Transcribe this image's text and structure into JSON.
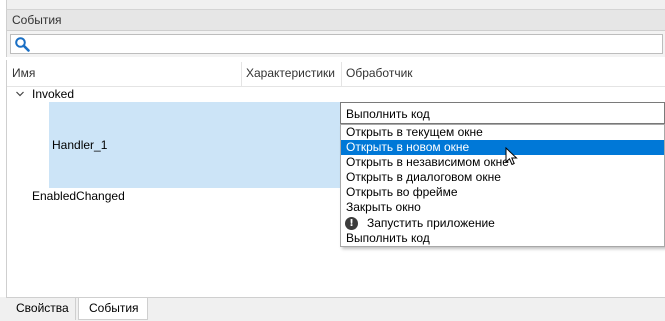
{
  "panel": {
    "title": "События"
  },
  "search": {
    "placeholder": "",
    "icon": "search-icon"
  },
  "grid": {
    "columns": [
      "Имя",
      "Характеристики",
      "Обработчик"
    ],
    "rows": [
      {
        "name": "Invoked",
        "expanded": true
      },
      {
        "name": "Handler_1",
        "selected": true
      },
      {
        "name": "EnabledChanged"
      }
    ]
  },
  "handler_combo": {
    "value": "Выполнить код",
    "options": [
      "Открыть в текущем окне",
      "Открыть в новом окне",
      "Открыть в независимом окне",
      "Открыть в диалоговом окне",
      "Открыть во фрейме",
      "Закрыть окно",
      "Запустить приложение",
      "Выполнить код"
    ],
    "highlighted": "Открыть в новом окне",
    "warning_icon_glyph": "!"
  },
  "tabs": [
    {
      "label": "Свойства",
      "active": false
    },
    {
      "label": "События",
      "active": true
    }
  ],
  "colors": {
    "selection": "#cce4f7",
    "highlight": "#0078d7",
    "header_bg": "#e6e6e6"
  }
}
